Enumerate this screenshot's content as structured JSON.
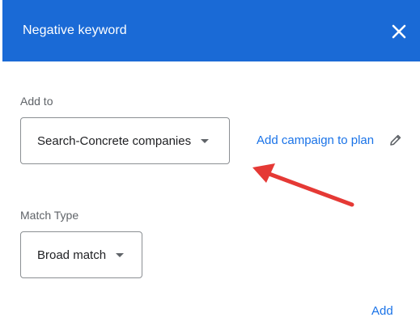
{
  "dialog": {
    "title": "Negative keyword",
    "close_icon": "close-icon"
  },
  "add_to": {
    "label": "Add to",
    "selected": "Search-Concrete companies",
    "link_text": "Add campaign to plan",
    "edit_icon": "pencil-icon"
  },
  "match_type": {
    "label": "Match Type",
    "selected": "Broad match"
  },
  "actions": {
    "add_label": "Add"
  },
  "annotation": {
    "arrow_color": "#e53935"
  },
  "colors": {
    "header_bg": "#1a6ad6",
    "link": "#1a73e8"
  }
}
